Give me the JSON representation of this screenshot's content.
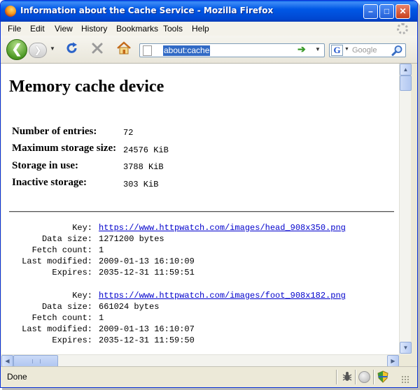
{
  "window": {
    "title": "Information about the Cache Service - Mozilla Firefox",
    "min_glyph": "–",
    "max_glyph": "□",
    "close_glyph": "✕"
  },
  "menu": [
    {
      "id": "file",
      "label": "File"
    },
    {
      "id": "edit",
      "label": "Edit"
    },
    {
      "id": "view",
      "label": "View"
    },
    {
      "id": "history",
      "label": "History"
    },
    {
      "id": "bookmarks",
      "label": "Bookmarks"
    },
    {
      "id": "tools",
      "label": "Tools"
    },
    {
      "id": "help",
      "label": "Help"
    }
  ],
  "toolbar": {
    "back_glyph": "❮",
    "forward_glyph": "❯",
    "url": "about:cache",
    "go_glyph": "➔",
    "search_engine_letter": "G",
    "search_placeholder": "Google"
  },
  "page": {
    "heading": "Memory cache device",
    "stats": [
      {
        "label": "Number of entries:",
        "value": "72"
      },
      {
        "label": "Maximum storage size:",
        "value": "24576 KiB"
      },
      {
        "label": "Storage in use:",
        "value": "3788 KiB"
      },
      {
        "label": "Inactive storage:",
        "value": "303 KiB"
      }
    ],
    "entry_labels": {
      "key": "Key:",
      "data_size": "Data size:",
      "fetch_count": "Fetch count:",
      "last_modified": "Last modified:",
      "expires": "Expires:"
    },
    "entries": [
      {
        "key": "https://www.httpwatch.com/images/head_908x350.png",
        "data_size": "1271200 bytes",
        "fetch_count": "1",
        "last_modified": "2009-01-13 16:10:09",
        "expires": "2035-12-31 11:59:51"
      },
      {
        "key": "https://www.httpwatch.com/images/foot_908x182.png",
        "data_size": "661024 bytes",
        "fetch_count": "1",
        "last_modified": "2009-01-13 16:10:07",
        "expires": "2035-12-31 11:59:50"
      }
    ]
  },
  "status": {
    "text": "Done"
  },
  "colors": {
    "titlebar": "#0058e6",
    "link": "#0000cc",
    "selection": "#316ac5"
  },
  "icons": [
    "firefox-logo-icon",
    "back-arrow-icon",
    "forward-arrow-icon",
    "reload-icon",
    "stop-icon",
    "home-icon",
    "page-icon",
    "go-arrow-icon",
    "google-icon",
    "magnifier-icon",
    "bug-icon",
    "status-circle-icon",
    "shield-icon"
  ]
}
